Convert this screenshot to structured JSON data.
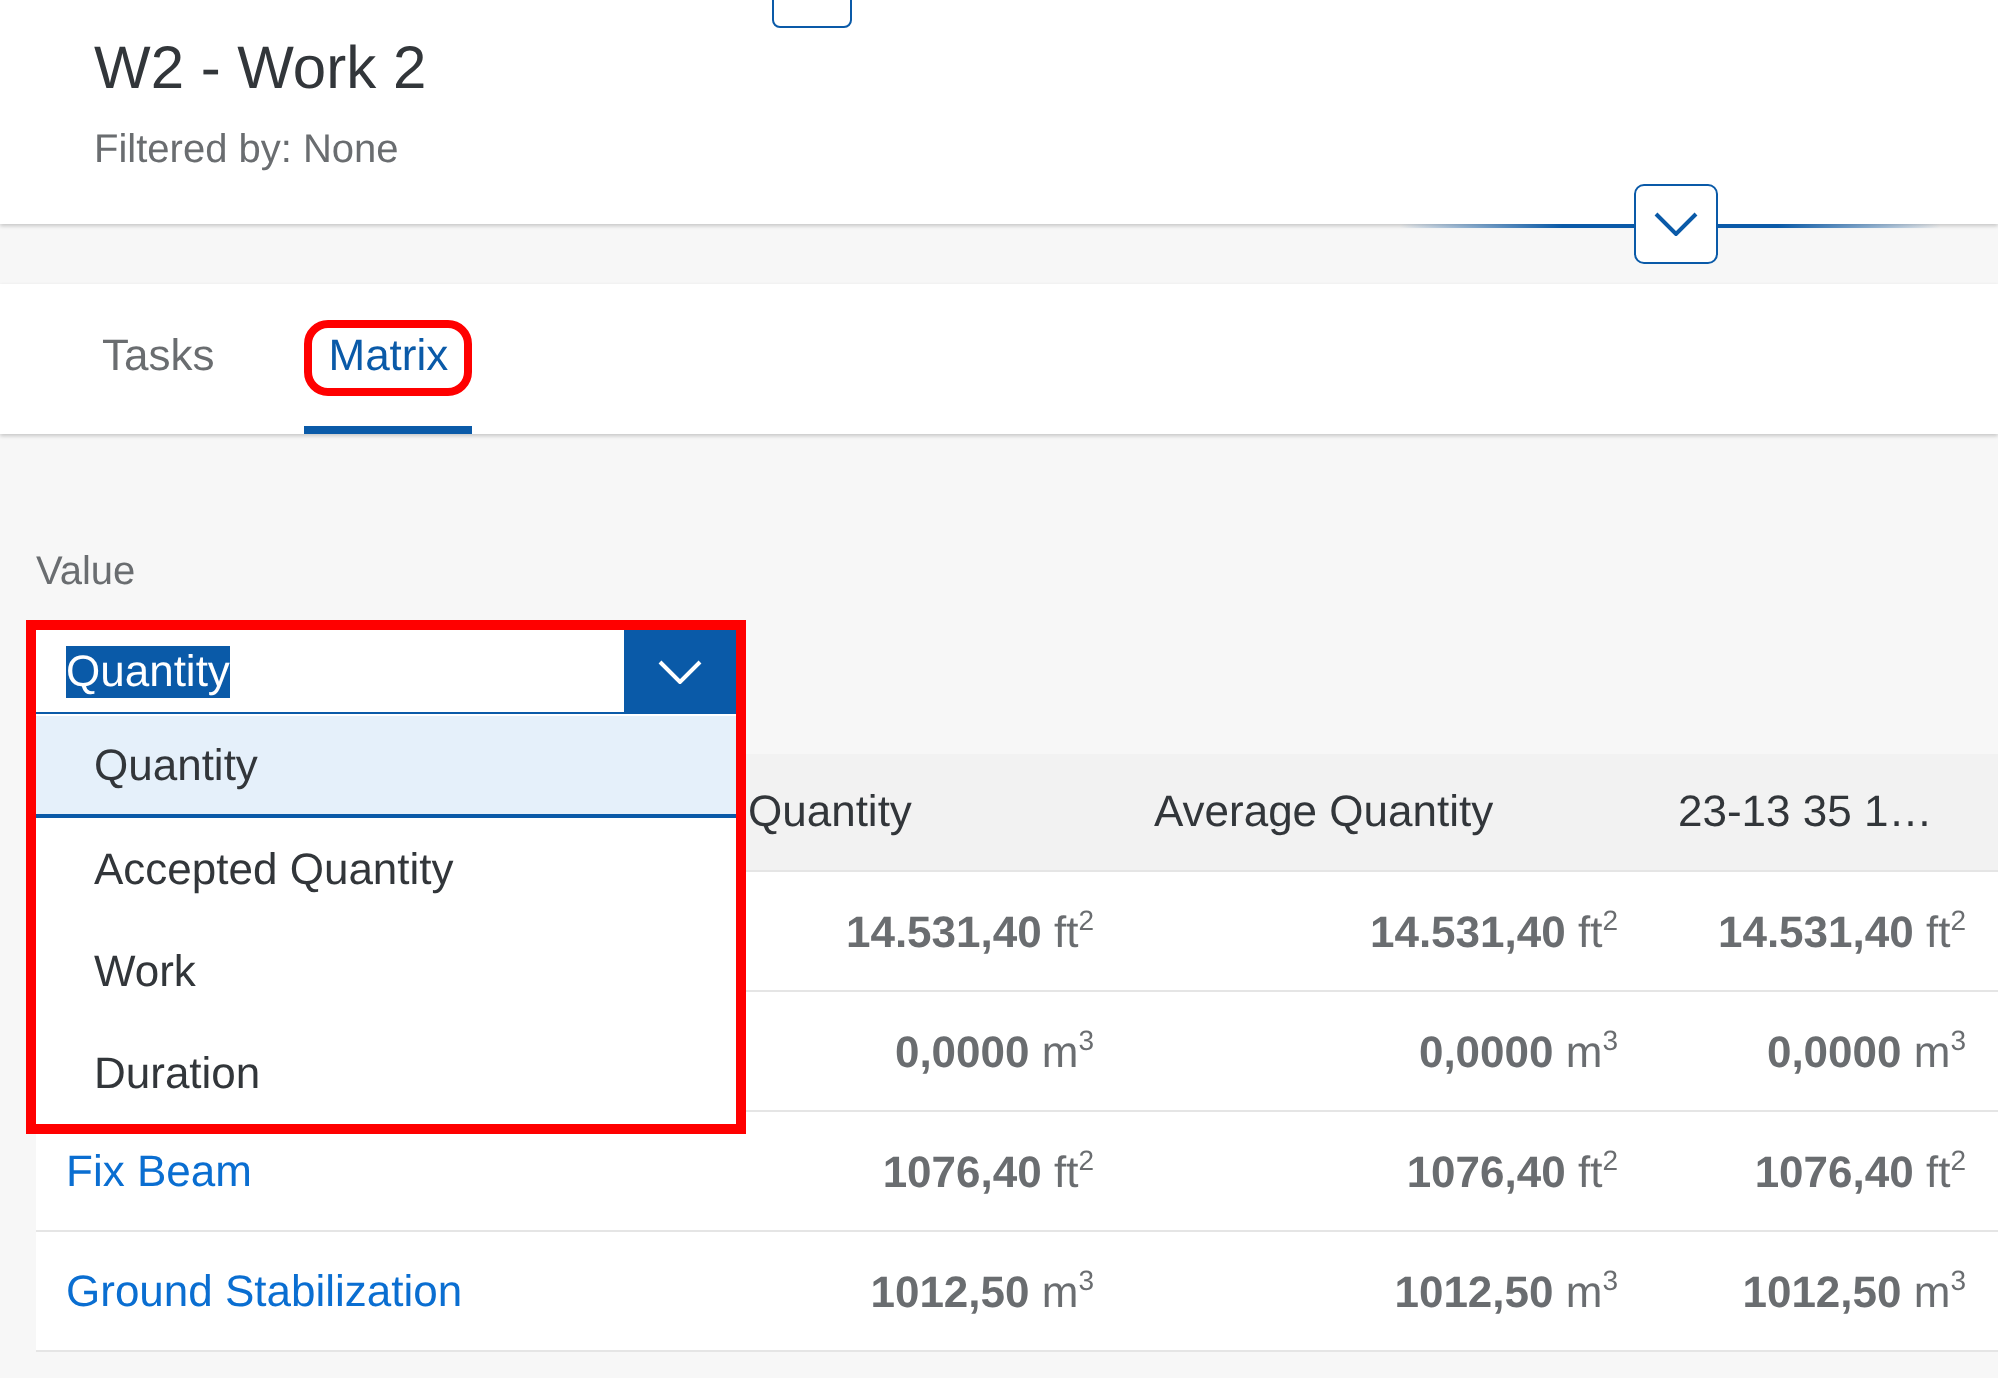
{
  "header": {
    "title": "W2 - Work 2",
    "subtitle": "Filtered by: None"
  },
  "tabs": [
    {
      "label": "Tasks",
      "selected": false,
      "highlighted": false
    },
    {
      "label": "Matrix",
      "selected": true,
      "highlighted": true
    }
  ],
  "value_select": {
    "label": "Value",
    "value": "Quantity",
    "text_selected": true,
    "expanded": true,
    "highlighted": true,
    "options": [
      {
        "label": "Quantity",
        "selected": true
      },
      {
        "label": "Accepted Quantity",
        "selected": false
      },
      {
        "label": "Work",
        "selected": false
      },
      {
        "label": "Duration",
        "selected": false
      }
    ]
  },
  "table": {
    "columns": [
      "Quantity",
      "Average Quantity",
      "23-13 35 1…"
    ],
    "rows": [
      {
        "name": "",
        "cells": [
          {
            "value": "14.531,40",
            "unit": "ft",
            "exp": "2"
          },
          {
            "value": "14.531,40",
            "unit": "ft",
            "exp": "2"
          },
          {
            "value": "14.531,40",
            "unit": "ft",
            "exp": "2"
          }
        ]
      },
      {
        "name": "",
        "cells": [
          {
            "value": "0,0000",
            "unit": "m",
            "exp": "3"
          },
          {
            "value": "0,0000",
            "unit": "m",
            "exp": "3"
          },
          {
            "value": "0,0000",
            "unit": "m",
            "exp": "3"
          }
        ]
      },
      {
        "name": "Fix Beam",
        "cells": [
          {
            "value": "1076,40",
            "unit": "ft",
            "exp": "2"
          },
          {
            "value": "1076,40",
            "unit": "ft",
            "exp": "2"
          },
          {
            "value": "1076,40",
            "unit": "ft",
            "exp": "2"
          }
        ]
      },
      {
        "name": "Ground Stabilization",
        "cells": [
          {
            "value": "1012,50",
            "unit": "m",
            "exp": "3"
          },
          {
            "value": "1012,50",
            "unit": "m",
            "exp": "3"
          },
          {
            "value": "1012,50",
            "unit": "m",
            "exp": "3"
          }
        ]
      }
    ]
  }
}
